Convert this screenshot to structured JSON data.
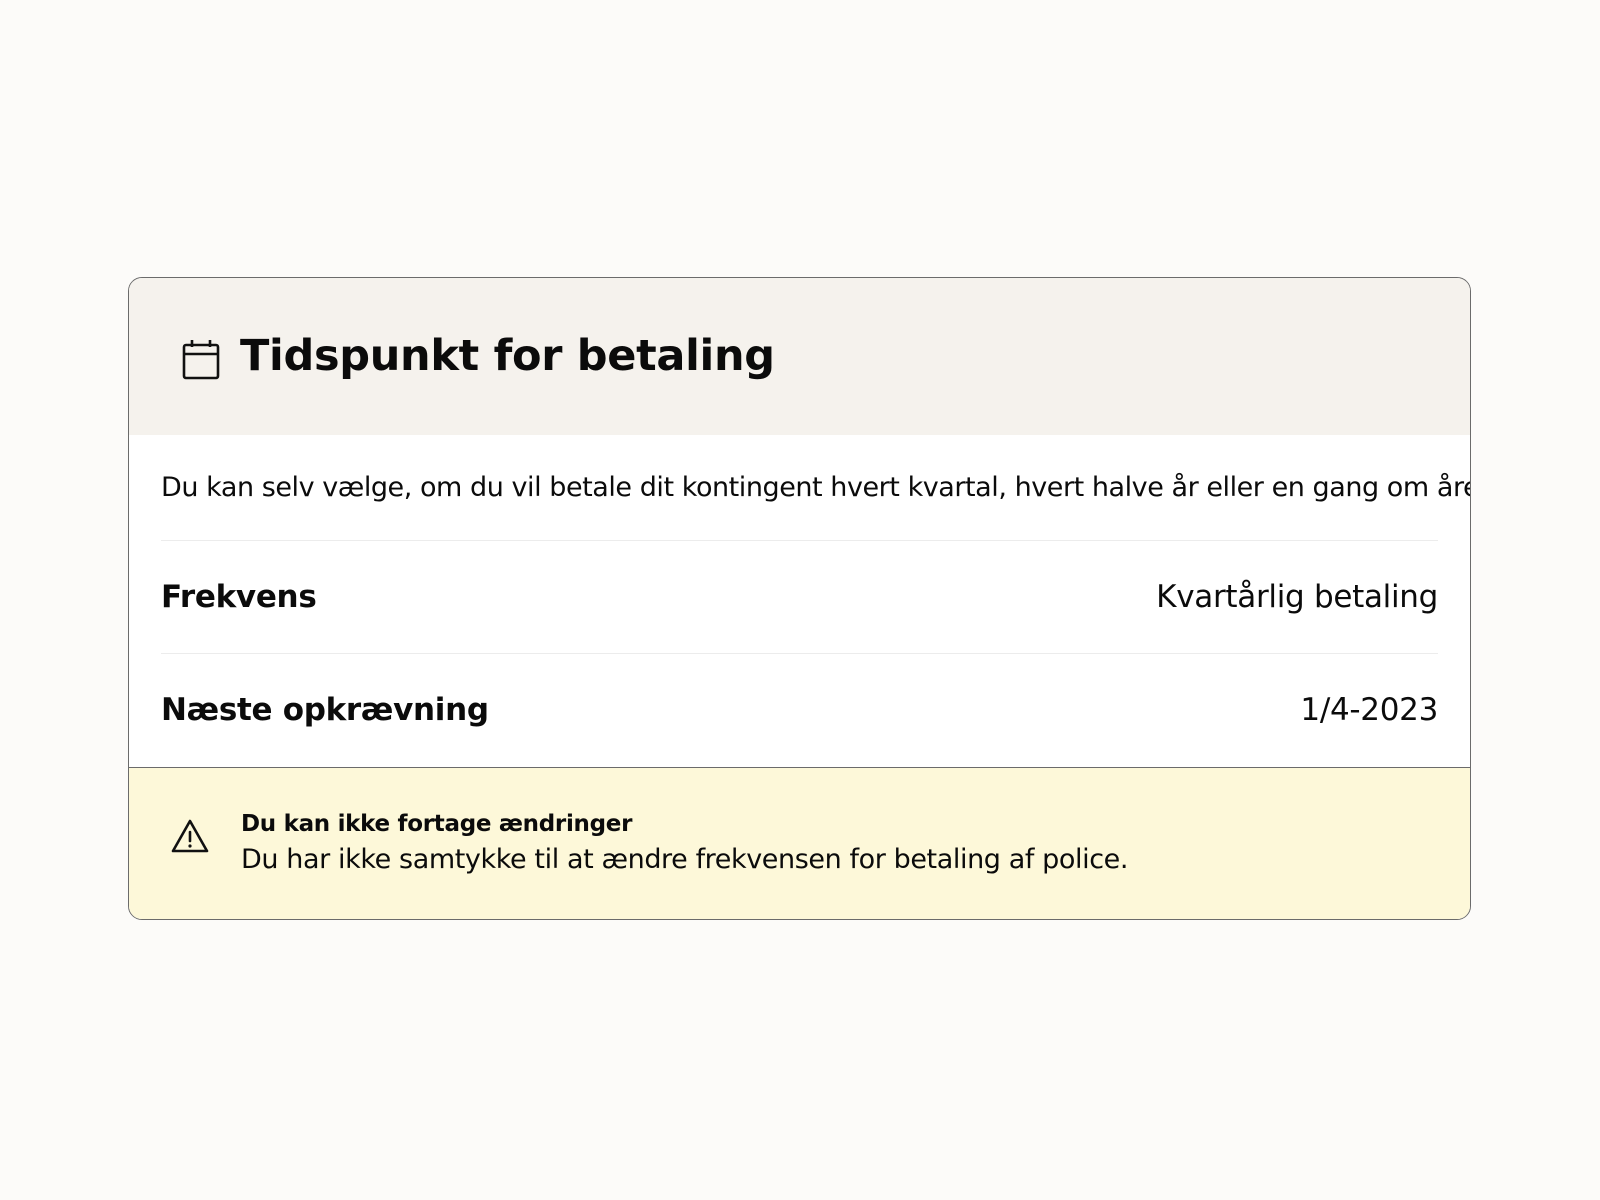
{
  "card": {
    "title": "Tidspunkt for betaling",
    "header_icon": "calendar-icon",
    "description": "Du kan selv vælge, om du vil betale dit kontingent hvert kvartal, hvert halve år eller en gang om året.",
    "rows": [
      {
        "label": "Frekvens",
        "value": "Kvartårlig betaling"
      },
      {
        "label": "Næste opkrævning",
        "value": "1/4-2023"
      }
    ]
  },
  "warning": {
    "icon": "warning-triangle-icon",
    "title": "Du kan ikke fortage ændringer",
    "message": "Du har ikke samtykke til at ændre frekvensen for betaling af police."
  },
  "colors": {
    "page_background": "#fcfbf9",
    "header_background": "#f5f2ed",
    "warning_background": "#fdf8d9",
    "border": "#6b6b6b",
    "text": "#0b0b0b"
  }
}
